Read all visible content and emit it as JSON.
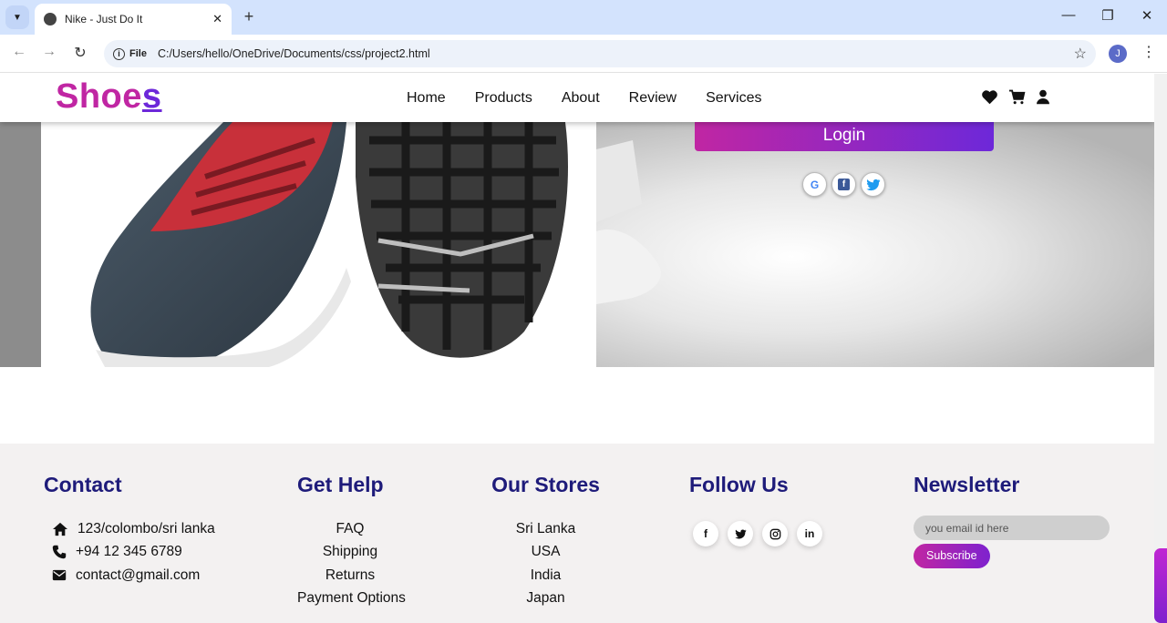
{
  "browser": {
    "tab_title": "Nike - Just Do It",
    "site_info_label": "File",
    "url": "C:/Users/hello/OneDrive/Documents/css/project2.html",
    "profile_initial": "J"
  },
  "header": {
    "logo_main": "Shoe",
    "logo_last": "s",
    "nav": [
      "Home",
      "Products",
      "About",
      "Review",
      "Services"
    ]
  },
  "hero": {
    "login_label": "Login",
    "social": [
      "G",
      "f",
      "twitter"
    ]
  },
  "footer": {
    "contact": {
      "title": "Contact",
      "address": "123/colombo/sri lanka",
      "phone": "+94 12 345 6789",
      "email": "contact@gmail.com"
    },
    "help": {
      "title": "Get Help",
      "items": [
        "FAQ",
        "Shipping",
        "Returns",
        "Payment Options"
      ]
    },
    "stores": {
      "title": "Our Stores",
      "items": [
        "Sri Lanka",
        "USA",
        "India",
        "Japan"
      ]
    },
    "follow": {
      "title": "Follow Us",
      "icons": [
        "f",
        "in"
      ]
    },
    "newsletter": {
      "title": "Newsletter",
      "placeholder": "you email id here",
      "subscribe_label": "Subscribe"
    }
  },
  "colors": {
    "brand_pink": "#c026a3",
    "brand_purple": "#6d28d9",
    "footer_heading": "#1e1b7a"
  }
}
